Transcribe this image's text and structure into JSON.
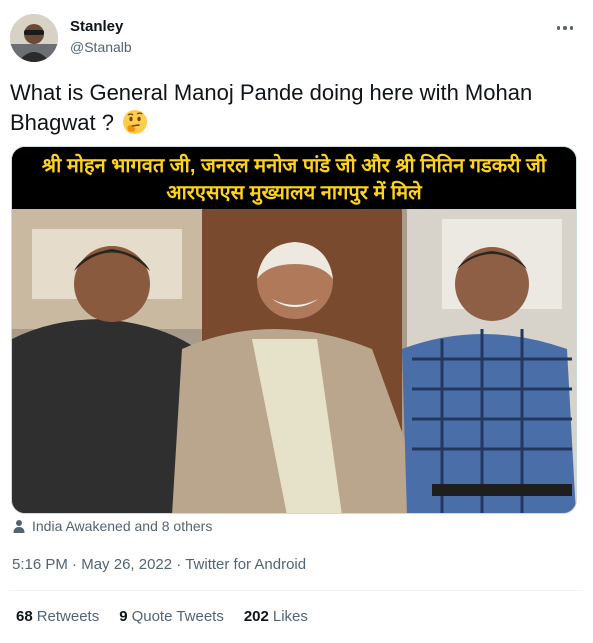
{
  "user": {
    "name": "Stanley",
    "handle": "@Stanalb"
  },
  "tweet": {
    "text": "What is General Manoj Pande doing here with Mohan Bhagwat ?"
  },
  "media": {
    "banner_line1": "श्री मोहन भागवत जी, जनरल मनोज पांडे जी और श्री नितिन गडकरी जी",
    "banner_line2": "आरएसएस मुख्यालय नागपुर में मिले"
  },
  "liked_by": "India Awakened and 8 others",
  "meta": {
    "time": "5:16 PM",
    "date": "May 26, 2022",
    "source": "Twitter for Android"
  },
  "stats": {
    "retweets_count": "68",
    "retweets_label": "Retweets",
    "quotes_count": "9",
    "quotes_label": "Quote Tweets",
    "likes_count": "202",
    "likes_label": "Likes"
  },
  "colors": {
    "banner_text": "#ffd21f",
    "secondary_text": "#536471",
    "primary_text": "#0f1419"
  }
}
